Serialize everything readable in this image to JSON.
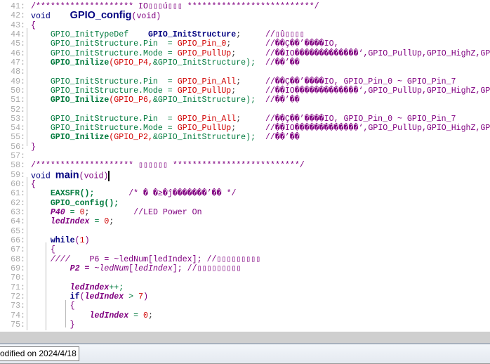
{
  "editor": {
    "lines": [
      {
        "n": "41:",
        "t": [
          [
            "/******************** IO▯▯▯ú▯▯▯ **************************/",
            "c"
          ]
        ]
      },
      {
        "n": "42:",
        "t": [
          [
            "void    ",
            "k"
          ],
          [
            "GPIO_config",
            "f"
          ],
          [
            "(void)",
            "c"
          ]
        ]
      },
      {
        "n": "43:",
        "t": [
          [
            "{",
            "c"
          ]
        ]
      },
      {
        "n": "44:",
        "t": [
          [
            "    GPIO_InitTypeDef    ",
            "g"
          ],
          [
            "GPIO_InitStructure",
            "kb"
          ],
          [
            ";     ",
            "p"
          ],
          [
            "//▯û▯▯▯▯",
            "c"
          ]
        ]
      },
      {
        "n": "45:",
        "t": [
          [
            "    GPIO_InitStructure.Pin  = ",
            "g"
          ],
          [
            "GPIO_Pin_0",
            "r"
          ],
          [
            ";       ",
            "p"
          ],
          [
            "//��Ç��’����IO,",
            "c"
          ]
        ]
      },
      {
        "n": "46:",
        "t": [
          [
            "    GPIO_InitStructure.Mode = ",
            "g"
          ],
          [
            "GPIO_PullUp",
            "r"
          ],
          [
            ";      ",
            "p"
          ],
          [
            "//��IO�������������‘,GPIO_PullUp,GPIO_HighZ,GPI",
            "c"
          ]
        ]
      },
      {
        "n": "47:",
        "t": [
          [
            "    GPIO_Inilize",
            "gb"
          ],
          [
            "(GPIO_P4,",
            "r"
          ],
          [
            "&GPIO_InitStructure);",
            "g"
          ],
          [
            "  //��’��",
            "c"
          ]
        ]
      },
      {
        "n": "48:",
        "t": []
      },
      {
        "n": "49:",
        "t": [
          [
            "    GPIO_InitStructure.Pin  = ",
            "g"
          ],
          [
            "GPIO_Pin_All",
            "r"
          ],
          [
            ";     ",
            "p"
          ],
          [
            "//��Ç��’����IO, GPIO_Pin_0 ~ GPIO_Pin_7",
            "c"
          ]
        ]
      },
      {
        "n": "50:",
        "t": [
          [
            "    GPIO_InitStructure.Mode = ",
            "g"
          ],
          [
            "GPIO_PullUp",
            "r"
          ],
          [
            ";      ",
            "p"
          ],
          [
            "//��IO�������������‘,GPIO_PullUp,GPIO_HighZ,GPI",
            "c"
          ]
        ]
      },
      {
        "n": "51:",
        "t": [
          [
            "    GPIO_Inilize",
            "gb"
          ],
          [
            "(GPIO_P6,",
            "r"
          ],
          [
            "&GPIO_InitStructure);",
            "g"
          ],
          [
            "  //��’��",
            "c"
          ]
        ]
      },
      {
        "n": "52:",
        "t": []
      },
      {
        "n": "53:",
        "t": [
          [
            "    GPIO_InitStructure.Pin  = ",
            "g"
          ],
          [
            "GPIO_Pin_All",
            "r"
          ],
          [
            ";     ",
            "p"
          ],
          [
            "//��Ç��’����IO, GPIO_Pin_0 ~ GPIO_Pin_7",
            "c"
          ]
        ]
      },
      {
        "n": "54:",
        "t": [
          [
            "    GPIO_InitStructure.Mode = ",
            "g"
          ],
          [
            "GPIO_PullUp",
            "r"
          ],
          [
            ";      ",
            "p"
          ],
          [
            "//��IO�������������‘,GPIO_PullUp,GPIO_HighZ,GPI",
            "c"
          ]
        ]
      },
      {
        "n": "55:",
        "t": [
          [
            "    GPIO_Inilize",
            "gb"
          ],
          [
            "(GPIO_P2,",
            "r"
          ],
          [
            "&GPIO_InitStructure);",
            "g"
          ],
          [
            "  //��’��",
            "c"
          ]
        ]
      },
      {
        "n": "56:",
        "t": [
          [
            "}",
            "c"
          ]
        ]
      },
      {
        "n": "57:",
        "t": []
      },
      {
        "n": "58:",
        "t": [
          [
            "/******************** ▯▯▯▯▯▯ **************************/",
            "c"
          ]
        ]
      },
      {
        "n": "59:",
        "t": [
          [
            "void ",
            "k"
          ],
          [
            "main",
            "f"
          ],
          [
            "(void)",
            "c"
          ]
        ]
      },
      {
        "n": "60:",
        "t": [
          [
            "{",
            "c"
          ]
        ]
      },
      {
        "n": "61:",
        "t": [
          [
            "    EAXSFR();",
            "gb"
          ],
          [
            "       /* � �≥�ĵ�������’�� */",
            "c"
          ]
        ]
      },
      {
        "n": "62:",
        "t": [
          [
            "    GPIO_config();",
            "gb"
          ]
        ]
      },
      {
        "n": "63:",
        "t": [
          [
            "    P40",
            "vb"
          ],
          [
            " = ",
            "g"
          ],
          [
            "0",
            "r"
          ],
          [
            ";         ",
            "p"
          ],
          [
            "//LED Power On",
            "c"
          ]
        ]
      },
      {
        "n": "64:",
        "t": [
          [
            "    ledIndex",
            "vb"
          ],
          [
            " = ",
            "g"
          ],
          [
            "0",
            "r"
          ],
          [
            ";",
            "p"
          ]
        ]
      },
      {
        "n": "65:",
        "t": []
      },
      {
        "n": "66:",
        "t": [
          [
            "    while",
            "kb"
          ],
          [
            "(",
            "c"
          ],
          [
            "1",
            "r"
          ],
          [
            ")",
            "c"
          ]
        ]
      },
      {
        "n": "67:",
        "t": [
          [
            "    {",
            "c"
          ]
        ]
      },
      {
        "n": "68:",
        "t": [
          [
            "    ////",
            "v"
          ],
          [
            "    P6 = ~ledNum[ledIndex]; //▯▯▯▯▯▯▯▯▯",
            "c"
          ]
        ]
      },
      {
        "n": "69:",
        "t": [
          [
            "        P2 = ",
            "vb"
          ],
          [
            "~",
            "c"
          ],
          [
            "ledNum",
            "v"
          ],
          [
            "[",
            "c"
          ],
          [
            "ledIndex",
            "v"
          ],
          [
            "]; //▯▯▯▯▯▯▯▯▯",
            "c"
          ]
        ]
      },
      {
        "n": "70:",
        "t": []
      },
      {
        "n": "71:",
        "t": [
          [
            "        ledIndex",
            "vb"
          ],
          [
            "++;",
            "g"
          ]
        ]
      },
      {
        "n": "72:",
        "t": [
          [
            "        if",
            "kb"
          ],
          [
            "(",
            "c"
          ],
          [
            "ledIndex",
            "vb"
          ],
          [
            " > ",
            "g"
          ],
          [
            "7",
            "r"
          ],
          [
            ")",
            "c"
          ]
        ]
      },
      {
        "n": "73:",
        "t": [
          [
            "        {",
            "c"
          ]
        ]
      },
      {
        "n": "74:",
        "t": [
          [
            "            ledIndex",
            "vb"
          ],
          [
            " = ",
            "g"
          ],
          [
            "0",
            "r"
          ],
          [
            ";",
            "p"
          ]
        ]
      },
      {
        "n": "75:",
        "t": [
          [
            "        }",
            "c"
          ]
        ]
      }
    ]
  },
  "status": {
    "text": "odified on 2024/4/18"
  }
}
